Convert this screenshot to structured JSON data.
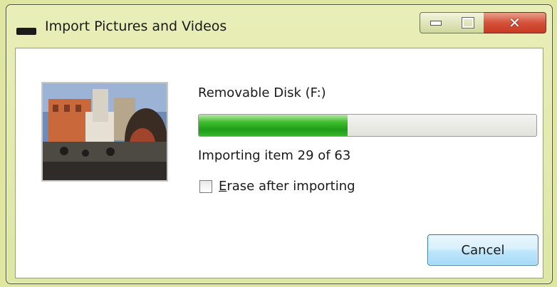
{
  "window": {
    "title": "Import Pictures and Videos",
    "icon": "import-device-icon",
    "controls": {
      "minimize": "minimize-icon",
      "maximize": "maximize-icon",
      "close": "close-icon"
    }
  },
  "dialog": {
    "source_label": "Removable Disk (F:)",
    "progress": {
      "fraction": 0.44,
      "color": "#2fb224"
    },
    "status": "Importing item 29 of 63",
    "erase_option": {
      "label_accel": "E",
      "label_rest": "rase after importing",
      "checked": false
    },
    "cancel_label": "Cancel",
    "thumbnail": "photo-thumbnail"
  },
  "colors": {
    "title_bar": "#e2ebad",
    "close_button": "#d4513a",
    "cancel_border": "#3c7fb1"
  }
}
